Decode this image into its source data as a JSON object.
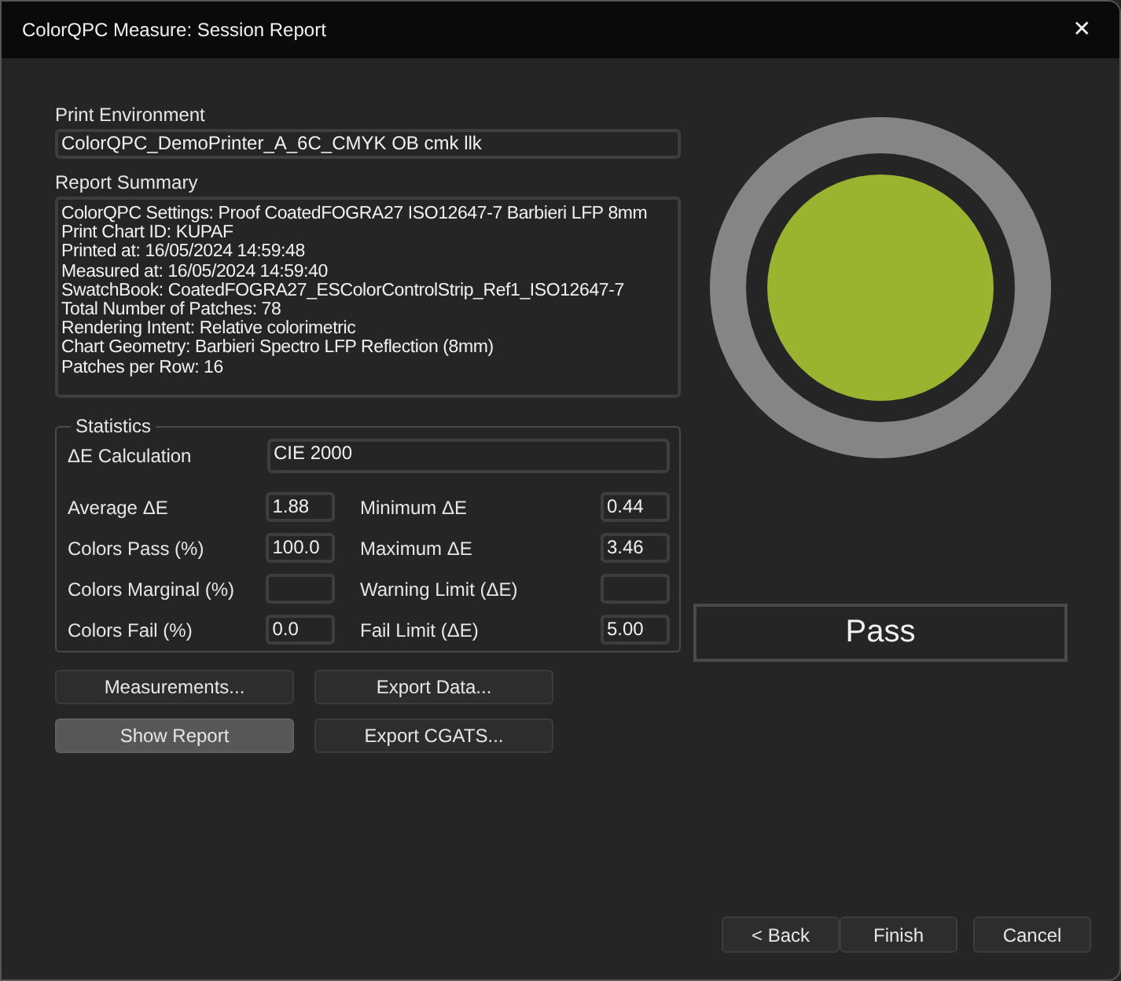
{
  "window": {
    "title": "ColorQPC Measure: Session Report",
    "close": "✕"
  },
  "print_environment": {
    "label": "Print Environment",
    "value": "ColorQPC_DemoPrinter_A_6C_CMYK OB cmk llk"
  },
  "report_summary": {
    "label": "Report Summary",
    "lines": [
      "ColorQPC Settings: Proof CoatedFOGRA27 ISO12647-7 Barbieri LFP 8mm",
      "Print Chart ID: KUPAF",
      "Printed at: 16/05/2024 14:59:48",
      "Measured at: 16/05/2024 14:59:40",
      "SwatchBook: CoatedFOGRA27_ESColorControlStrip_Ref1_ISO12647-7",
      "Total Number of Patches: 78",
      "Rendering Intent: Relative colorimetric",
      "Chart Geometry: Barbieri Spectro LFP Reflection (8mm)",
      "Patches per Row: 16"
    ]
  },
  "statistics": {
    "title": "Statistics",
    "calculation": {
      "label": "ΔE Calculation",
      "value": "CIE 2000"
    },
    "fields": [
      {
        "label": "Average ΔE",
        "value": "1.88"
      },
      {
        "label": "Minimum ΔE",
        "value": "0.44"
      },
      {
        "label": "Colors Pass (%)",
        "value": "100.0"
      },
      {
        "label": "Maximum ΔE",
        "value": "3.46"
      },
      {
        "label": "Colors Marginal (%)"
      },
      {
        "label": "Warning Limit (ΔE)"
      },
      {
        "label": "Colors Fail (%)",
        "value": "0.0"
      },
      {
        "label": "Fail Limit (ΔE)",
        "value": "5.00"
      }
    ]
  },
  "actions": [
    {
      "label": "Measurements...",
      "pressed": false
    },
    {
      "label": "Export Data...",
      "pressed": false
    },
    {
      "label": "Show Report",
      "pressed": true
    },
    {
      "label": "Export CGATS...",
      "pressed": false
    }
  ],
  "result": {
    "kind": "pass",
    "label": "Pass"
  },
  "footer_buttons": [
    "< Back",
    "Finish",
    "Cancel"
  ]
}
